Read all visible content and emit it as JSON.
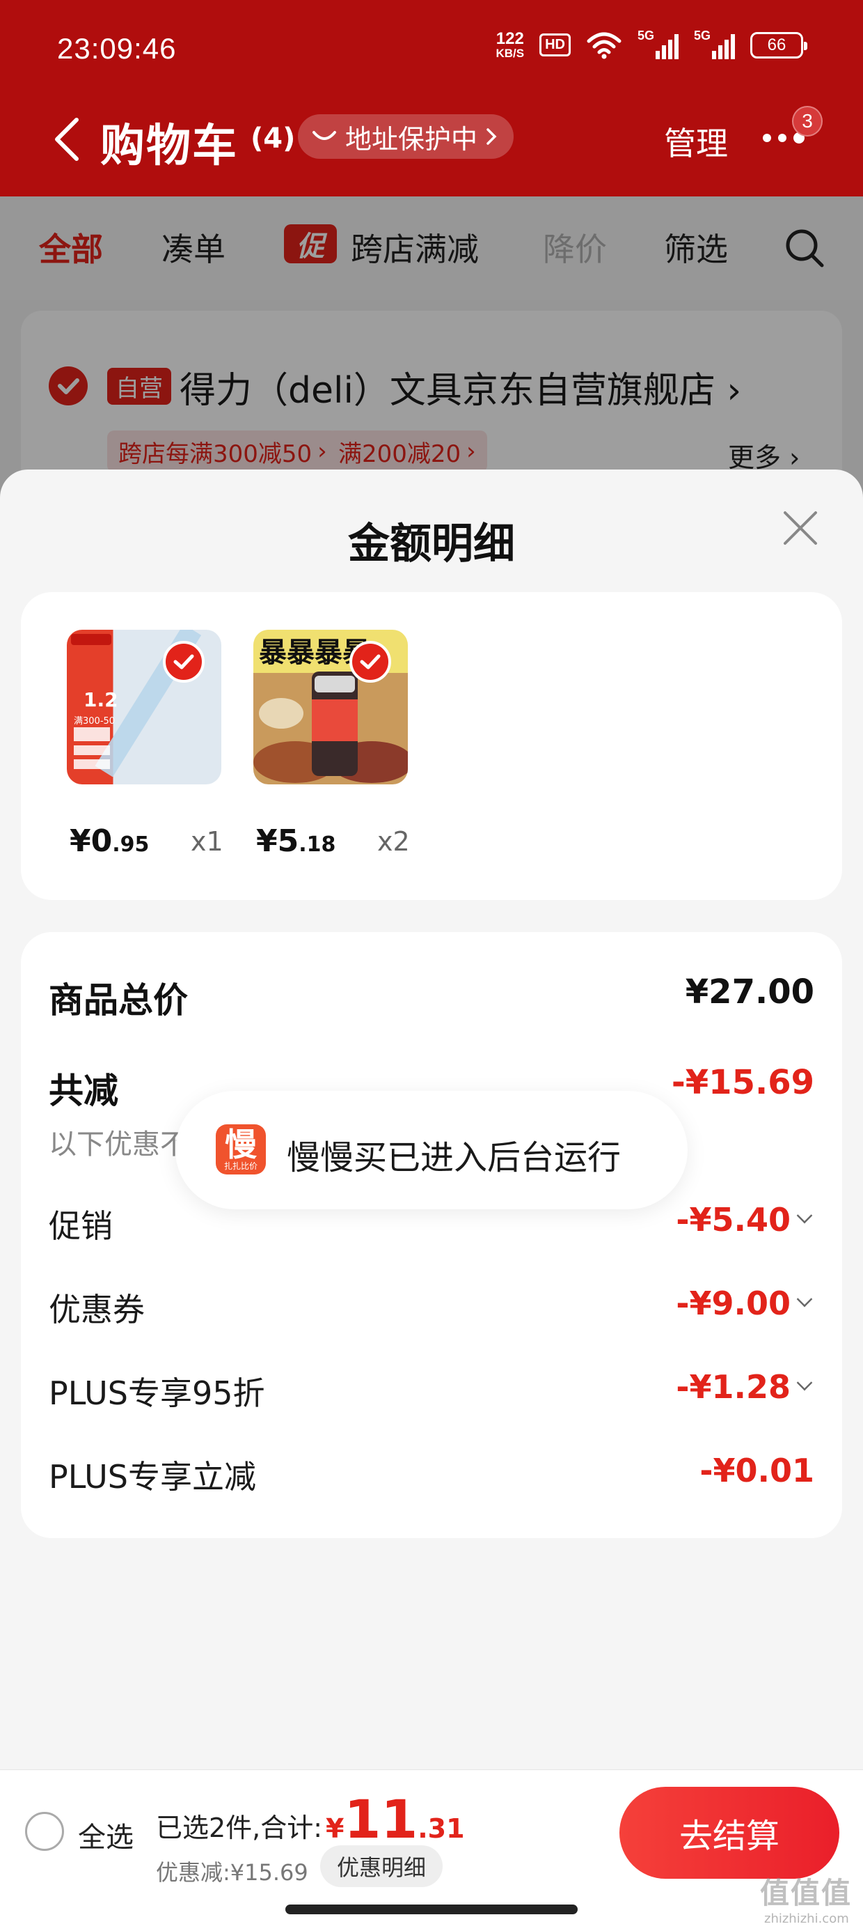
{
  "status_bar": {
    "time": "23:09:46",
    "speed_value": "122",
    "speed_unit": "KB/S",
    "hd": "HD",
    "net1": "5G",
    "net2": "5G",
    "battery": "66"
  },
  "header": {
    "title": "购物车",
    "count": "(4)",
    "address_protect": "地址保护中",
    "manage": "管理",
    "more_badge": "3"
  },
  "tabs": {
    "all": "全部",
    "bundle": "凑单",
    "promo_tag": "促",
    "cross_store": "跨店满减",
    "price_drop": "降价",
    "filter": "筛选"
  },
  "store": {
    "self_tag": "自营",
    "name": "得力（deli）文具京东自营旗舰店",
    "chip1": "跨店每满300减50",
    "chip2": "满200减20",
    "more": "更多"
  },
  "sheet": {
    "title": "金额明细",
    "items": [
      {
        "price_int": "¥0",
        "price_dec": ".95",
        "qty": "x1",
        "thumb_text": "1.2",
        "thumb_sub": "满300-50"
      },
      {
        "price_int": "¥5",
        "price_dec": ".18",
        "qty": "x2",
        "thumb_text": "暴暴暴暴"
      }
    ],
    "summary": {
      "total_label": "商品总价",
      "total_value": "¥27.00",
      "reduce_label": "共减",
      "reduce_value": "-¥15.69",
      "note": "以下优惠不包含红包，请在结算页查看",
      "lines": [
        {
          "label": "促销",
          "value": "-¥5.40"
        },
        {
          "label": "优惠券",
          "value": "-¥9.00"
        },
        {
          "label": "PLUS专享95折",
          "value": "-¥1.28"
        },
        {
          "label": "PLUS专享立减",
          "value": "-¥0.01"
        }
      ]
    }
  },
  "toast": {
    "logo": "慢",
    "logo_sub": "扎扎比价",
    "text": "慢慢买已进入后台运行"
  },
  "bottom": {
    "select_all": "全选",
    "selected": "已选2件,合计:",
    "yen": "¥",
    "total_int": "11",
    "total_dec": ".31",
    "discount": "优惠减:¥15.69",
    "detail": "优惠明细",
    "checkout": "去结算"
  },
  "watermark": {
    "mark": "值值值",
    "site": "zhizhizhi.com"
  },
  "colors": {
    "header_red": "#b00d0d",
    "accent_red": "#e2231a"
  }
}
